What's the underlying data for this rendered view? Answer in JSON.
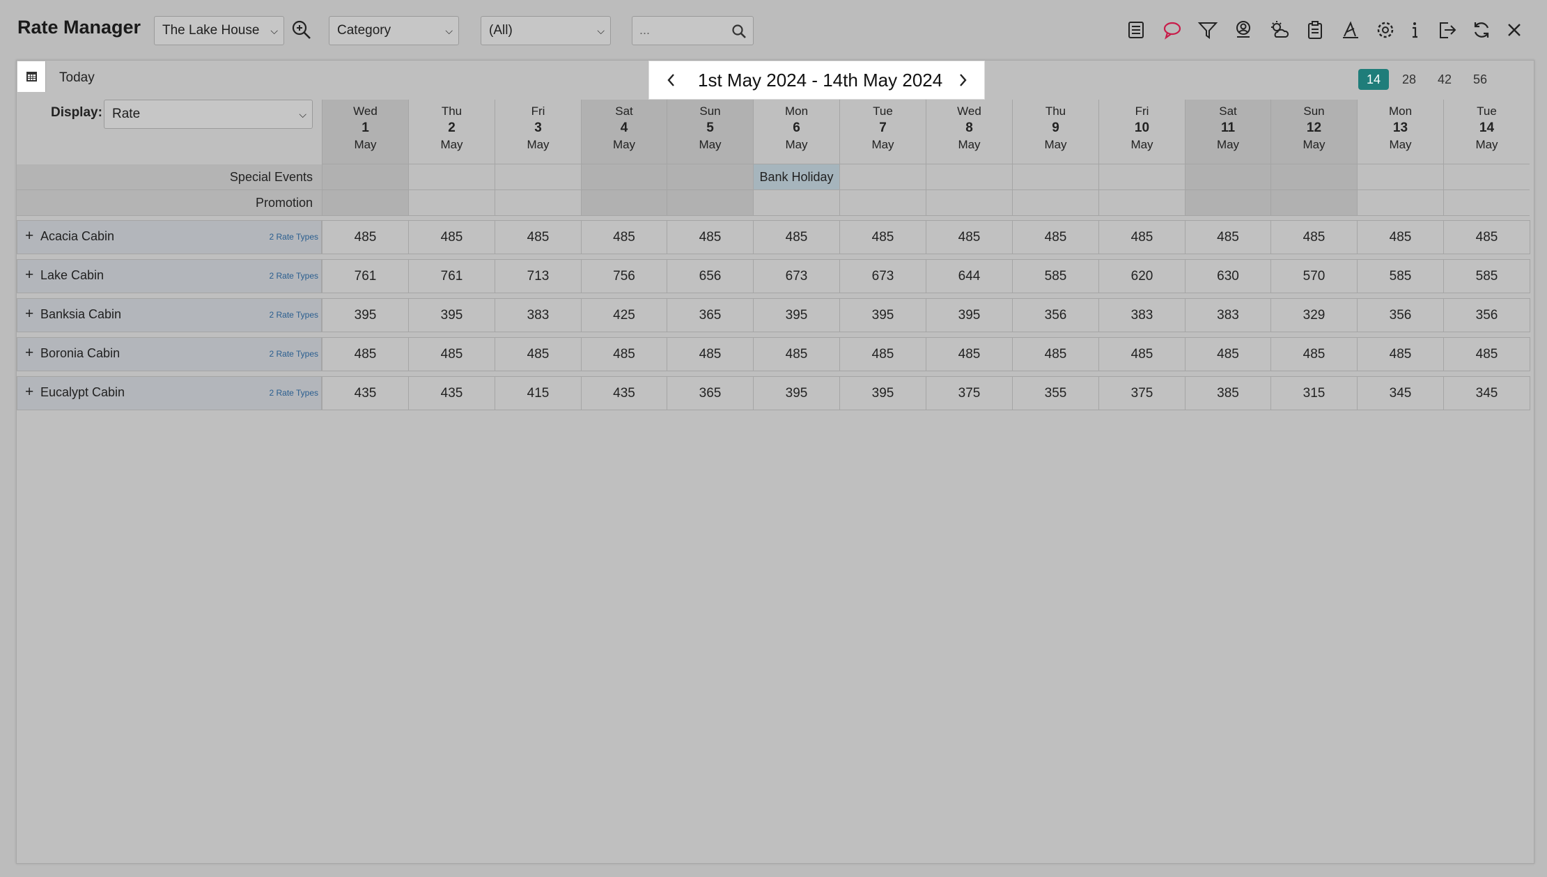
{
  "app": {
    "title": "Rate Manager"
  },
  "toolbar": {
    "property": "The Lake House",
    "grouping": "Category",
    "filter": "(All)",
    "search_placeholder": "...",
    "icons": [
      "report-icon",
      "chat-icon",
      "filter-icon",
      "guest-icon",
      "weather-icon",
      "clipboard-icon",
      "rate-chart-icon",
      "settings-icon",
      "info-icon",
      "logout-icon",
      "refresh-icon",
      "close-icon"
    ]
  },
  "nav": {
    "today": "Today",
    "date_range": "1st May 2024 - 14th May 2024",
    "spans": [
      "14",
      "28",
      "42",
      "56"
    ],
    "active_span": "14"
  },
  "display": {
    "label": "Display:",
    "value": "Rate"
  },
  "days": [
    {
      "name": "Wed",
      "num": "1",
      "mon": "May",
      "weekend": true
    },
    {
      "name": "Thu",
      "num": "2",
      "mon": "May",
      "weekend": false
    },
    {
      "name": "Fri",
      "num": "3",
      "mon": "May",
      "weekend": false
    },
    {
      "name": "Sat",
      "num": "4",
      "mon": "May",
      "weekend": true
    },
    {
      "name": "Sun",
      "num": "5",
      "mon": "May",
      "weekend": true
    },
    {
      "name": "Mon",
      "num": "6",
      "mon": "May",
      "weekend": false
    },
    {
      "name": "Tue",
      "num": "7",
      "mon": "May",
      "weekend": false
    },
    {
      "name": "Wed",
      "num": "8",
      "mon": "May",
      "weekend": false
    },
    {
      "name": "Thu",
      "num": "9",
      "mon": "May",
      "weekend": false
    },
    {
      "name": "Fri",
      "num": "10",
      "mon": "May",
      "weekend": false
    },
    {
      "name": "Sat",
      "num": "11",
      "mon": "May",
      "weekend": true
    },
    {
      "name": "Sun",
      "num": "12",
      "mon": "May",
      "weekend": true
    },
    {
      "name": "Mon",
      "num": "13",
      "mon": "May",
      "weekend": false
    },
    {
      "name": "Tue",
      "num": "14",
      "mon": "May",
      "weekend": false
    }
  ],
  "events": [
    {
      "label": "Special Events",
      "cells": {
        "5": "Bank Holiday"
      }
    },
    {
      "label": "Promotion",
      "cells": {}
    }
  ],
  "rooms": [
    {
      "name": "Acacia Cabin",
      "rate_types": "2 Rate Types",
      "rates": [
        485,
        485,
        485,
        485,
        485,
        485,
        485,
        485,
        485,
        485,
        485,
        485,
        485,
        485
      ]
    },
    {
      "name": "Lake Cabin",
      "rate_types": "2 Rate Types",
      "rates": [
        761,
        761,
        713,
        756,
        656,
        673,
        673,
        644,
        585,
        620,
        630,
        570,
        585,
        585
      ]
    },
    {
      "name": "Banksia Cabin",
      "rate_types": "2 Rate Types",
      "rates": [
        395,
        395,
        383,
        425,
        365,
        395,
        395,
        395,
        356,
        383,
        383,
        329,
        356,
        356
      ]
    },
    {
      "name": "Boronia Cabin",
      "rate_types": "2 Rate Types",
      "rates": [
        485,
        485,
        485,
        485,
        485,
        485,
        485,
        485,
        485,
        485,
        485,
        485,
        485,
        485
      ]
    },
    {
      "name": "Eucalypt Cabin",
      "rate_types": "2 Rate Types",
      "rates": [
        435,
        435,
        415,
        435,
        365,
        395,
        395,
        375,
        355,
        375,
        385,
        315,
        345,
        345
      ]
    }
  ]
}
